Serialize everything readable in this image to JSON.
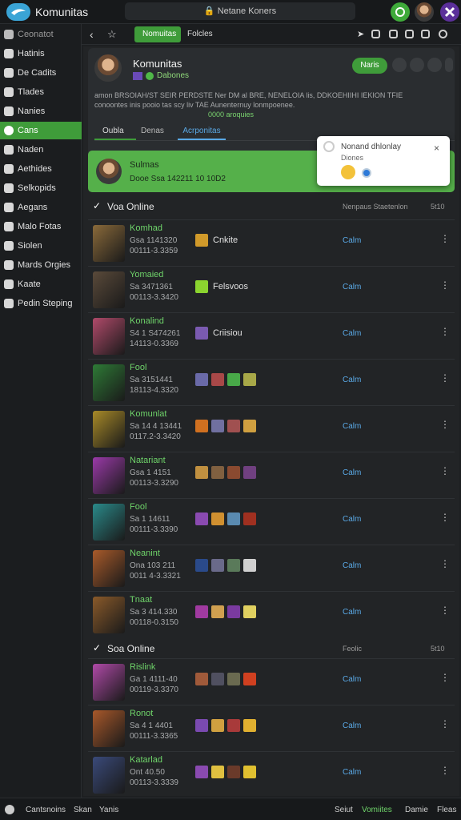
{
  "header": {
    "app_name": "Komunitas",
    "address": "Netane Koners",
    "lock_icon": "lock-icon"
  },
  "sidebar": {
    "collapsed_label": "Ceonatot",
    "items": [
      {
        "label": "Hatinis",
        "icon": "home-icon"
      },
      {
        "label": "De Cadits",
        "icon": "bookmark-icon"
      },
      {
        "label": "Tlades",
        "icon": "bookmark-icon"
      },
      {
        "label": "Nanies",
        "icon": "bookmark-icon"
      },
      {
        "label": "Cans",
        "icon": "chat-icon",
        "active": true
      },
      {
        "label": "Naden",
        "icon": "globe-icon"
      },
      {
        "label": "Aethides",
        "icon": "swords-icon"
      },
      {
        "label": "Selkopids",
        "icon": "gear-icon"
      },
      {
        "label": "Aegans",
        "icon": "controller-icon"
      },
      {
        "label": "Malo Fotas",
        "icon": "gear-icon"
      },
      {
        "label": "Siolen",
        "icon": "star-icon"
      },
      {
        "label": "Mards Orgies",
        "icon": "flag-icon"
      },
      {
        "label": "Kaate",
        "icon": "leaf-icon"
      },
      {
        "label": "Pedin Steping",
        "icon": "book-icon"
      }
    ]
  },
  "toolbar": {
    "tab_active": "Nomuitas",
    "tab_other": "Folcles"
  },
  "profile": {
    "name": "Komunitas",
    "status": "Dabones",
    "button": "Naris",
    "desc1": "amon BRSOIAH/ST SEIR PERDSTE Ner DM al BRE, NENELOIA lis, DDKOEHIIHI IEKION TFIE",
    "desc2": "conoontes inis pooio tas scy liv TAE Aunenternuy lonmpoenee.",
    "desc3": "0000 aroquies",
    "tabs": [
      "Oubla",
      "Denas",
      "Acrponitas"
    ]
  },
  "highlight": {
    "name": "Sulmas",
    "sub": "Dooe Ssa 142211 10 10D2"
  },
  "popup": {
    "title": "Nonand dhlonlay",
    "sub": "Diones"
  },
  "sections": [
    {
      "title": "Voa Online",
      "right": "Nenpaus Staetenlon",
      "count": "5t10"
    },
    {
      "title": "Soa Online",
      "right": "Feolic",
      "count": "5t10"
    }
  ],
  "rows": [
    {
      "name": "Komhad",
      "l1": "Gsa 1141320",
      "l2": "00111-3.3359",
      "status": "Cnkite",
      "action": "Calm",
      "thumb": "#8a6a3a",
      "squares": [
        "#d19a2a"
      ]
    },
    {
      "name": "Yomaied",
      "l1": "Sa 3471361",
      "l2": "00113-3.3420",
      "status": "Felsvoos",
      "action": "Calm",
      "thumb": "#5a4a3a",
      "squares": [
        "#8bd42f"
      ]
    },
    {
      "name": "Konalind",
      "l1": "S4 1 S474261",
      "l2": "14113-0.3369",
      "status": "Criisiou",
      "action": "Calm",
      "thumb": "#b04a6a",
      "squares": [
        "#7a5ab0"
      ]
    },
    {
      "name": "Fool",
      "l1": "Sa 3151441",
      "l2": "18113-4.3320",
      "status": "",
      "action": "Calm",
      "thumb": "#2e7a36",
      "squares": [
        "#6a6aa8",
        "#a84848",
        "#48a848",
        "#a8a848"
      ]
    },
    {
      "name": "Komunlat",
      "l1": "Sa 14 4 13441",
      "l2": "0117.2-3.3420",
      "status": "",
      "action": "Calm",
      "thumb": "#a88a28",
      "squares": [
        "#d07020",
        "#7070a0",
        "#a05050",
        "#d0a040"
      ]
    },
    {
      "name": "Natariant",
      "l1": "Gsa 1 4151",
      "l2": "00113-3.3290",
      "status": "",
      "action": "Calm",
      "thumb": "#9a3aa8",
      "squares": [
        "#c09040",
        "#806040",
        "#8a4a30",
        "#704080"
      ]
    },
    {
      "name": "Fool",
      "l1": "Sa 1 14611",
      "l2": "00111-3.3390",
      "status": "",
      "action": "Calm",
      "thumb": "#2a8a8a",
      "squares": [
        "#8a4ab0",
        "#d09030",
        "#5a8ab0",
        "#a03020"
      ]
    },
    {
      "name": "Neanint",
      "l1": "Ona 103 211",
      "l2": "0011 4-3.3321",
      "status": "",
      "action": "Calm",
      "thumb": "#a85a2a",
      "squares": [
        "#2a4a8a",
        "#6a6a8a",
        "#5a7a5a",
        "#d0d0d0"
      ]
    },
    {
      "name": "Tnaat",
      "l1": "Sa 3 414.330",
      "l2": "00118-0.3150",
      "status": "",
      "action": "Calm",
      "thumb": "#8a5a2a",
      "squares": [
        "#a03aa0",
        "#d0a050",
        "#7a3aa0",
        "#e0d060"
      ]
    },
    {
      "name": "Rislink",
      "l1": "Ga 1 4111-40",
      "l2": "00119-3.3370",
      "status": "",
      "action": "Calm",
      "thumb": "#b04aa8",
      "squares": [
        "#a05a3a",
        "#505060",
        "#6a6a50",
        "#d04020"
      ]
    },
    {
      "name": "Ronot",
      "l1": "Sa 4 1 4401",
      "l2": "00111-3.3365",
      "status": "",
      "action": "Calm",
      "thumb": "#a8582a",
      "squares": [
        "#7a4ab0",
        "#d0a040",
        "#a83a3a",
        "#e0b030"
      ]
    },
    {
      "name": "Katarlad",
      "l1": "Ont 40.50",
      "l2": "00113-3.3339",
      "status": "",
      "action": "Calm",
      "thumb": "#3a4a7a",
      "squares": [
        "#8a4ab0",
        "#e0c040",
        "#6a3a2a",
        "#e0c030"
      ]
    }
  ],
  "footer": {
    "items": [
      "Cantsnoins",
      "Skan",
      "Yanis"
    ],
    "right": [
      "Seiut",
      "Vomiites",
      "Damie",
      "Fleas"
    ]
  }
}
